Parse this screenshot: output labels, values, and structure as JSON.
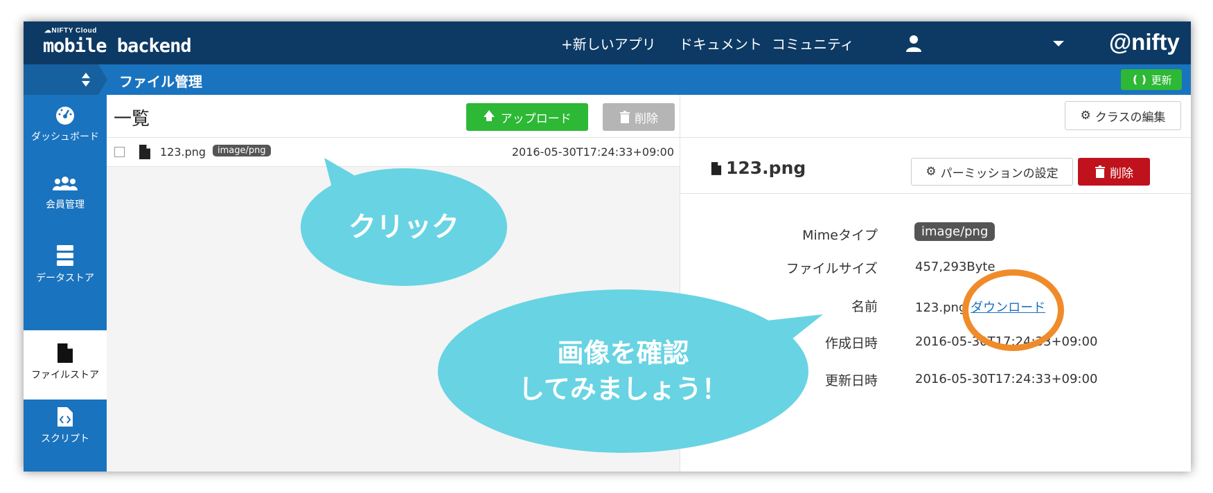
{
  "topbar": {
    "logo_small": "☁NIFTY Cloud",
    "logo_big": "mobile backend",
    "nav": [
      "+新しいアプリ",
      "ドキュメント",
      "コミュニティ"
    ],
    "brand": "@nifty"
  },
  "subbar": {
    "title": "ファイル管理",
    "refresh_label": "更新"
  },
  "sidebar": {
    "items": [
      {
        "label": "ダッシュボード",
        "icon": "dashboard-icon"
      },
      {
        "label": "会員管理",
        "icon": "users-icon"
      },
      {
        "label": "データストア",
        "icon": "datastore-icon"
      },
      {
        "label": "ファイルストア",
        "icon": "file-icon",
        "active": true
      },
      {
        "label": "スクリプト",
        "icon": "script-icon"
      }
    ]
  },
  "list": {
    "title": "一覧",
    "upload_label": "アップロード",
    "delete_label": "削除",
    "rows": [
      {
        "name": "123.png",
        "type": "image/png",
        "date": "2016-05-30T17:24:33+09:00"
      }
    ]
  },
  "detail": {
    "class_edit_label": "クラスの編集",
    "file_title": "123.png",
    "permission_label": "パーミッションの設定",
    "delete_label": "削除",
    "props": {
      "mime_label": "Mimeタイプ",
      "mime_value": "image/png",
      "size_label": "ファイルサイズ",
      "size_value": "457,293Byte",
      "name_label": "名前",
      "name_value": "123.png",
      "download_label": "ダウンロード",
      "created_label": "作成日時",
      "created_value": "2016-05-30T17:24:33+09:00",
      "updated_label": "更新日時",
      "updated_value": "2016-05-30T17:24:33+09:00"
    }
  },
  "annotations": {
    "bubble1": "クリック",
    "bubble2_line1": "画像を確認",
    "bubble2_line2": "してみましょう！",
    "bubble_color": "#68d3e3",
    "ring_color": "#f08b2a"
  }
}
